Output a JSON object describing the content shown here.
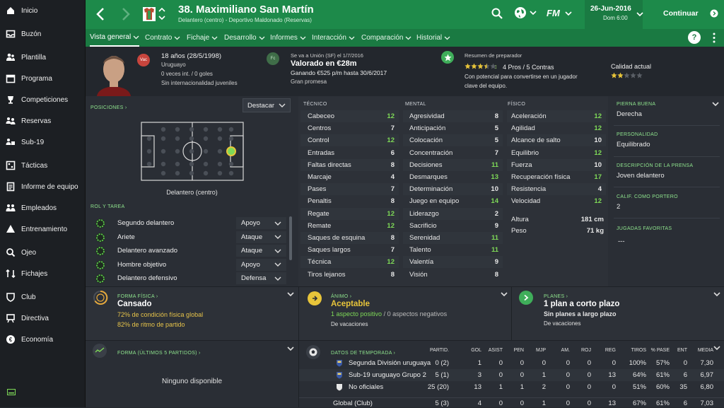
{
  "sidebar": {
    "items": [
      {
        "label": "Inicio",
        "icon": "home-icon"
      },
      {
        "label": "Buzón",
        "icon": "inbox-icon"
      },
      {
        "label": "Plantilla",
        "icon": "squad-icon"
      },
      {
        "label": "Programa",
        "icon": "schedule-icon"
      },
      {
        "label": "Competiciones",
        "icon": "trophy-icon"
      },
      {
        "label": "Reservas",
        "icon": "reserves-icon"
      },
      {
        "label": "Sub-19",
        "icon": "u19-icon"
      },
      {
        "label": "Tácticas",
        "icon": "tactics-icon"
      },
      {
        "label": "Informe de equipo",
        "icon": "report-icon"
      },
      {
        "label": "Empleados",
        "icon": "staff-icon"
      },
      {
        "label": "Entrenamiento",
        "icon": "training-icon"
      },
      {
        "label": "Ojeo",
        "icon": "scouting-icon"
      },
      {
        "label": "Fichajes",
        "icon": "transfers-icon"
      },
      {
        "label": "Club",
        "icon": "club-icon"
      },
      {
        "label": "Directiva",
        "icon": "board-icon"
      },
      {
        "label": "Economía",
        "icon": "finance-icon"
      }
    ]
  },
  "header": {
    "title": "38. Maximiliano San Martín",
    "subtitle": "Delantero (centro) - Deportivo Maldonado (Reservas)",
    "logo": "FM",
    "date": "26-Jun-2016",
    "time": "Dom 6:00",
    "continue": "Continuar"
  },
  "tabs": [
    "Vista general",
    "Contrato",
    "Fichaje",
    "Desarrollo",
    "Informes",
    "Interacción",
    "Comparación",
    "Historial"
  ],
  "profile": {
    "age": "18 años (28/5/1998)",
    "nationality": "Uruguayo",
    "caps": "0 veces int. / 0 goles",
    "youth": "Sin internacionalidad juveniles",
    "badge": "Vac",
    "contract_badge": "Fc",
    "transfer_note": "Se va a Unión (SF) el 1/7/2016",
    "valued": "Valorado en €28m",
    "wage": "Ganando €525 p/m hasta 30/6/2017",
    "promise": "Gran promesa"
  },
  "coach": {
    "heading": "Resumen de preparador",
    "pros": "4 Pros / 5 Contras",
    "desc1": "Con potencial para convertirse en un jugador",
    "desc2": "clave del equipo.",
    "ability_label": "Calidad actual",
    "stars_potential": 3.5,
    "stars_current": 2
  },
  "positions": {
    "heading": "POSICIONES",
    "dropdown": "Destacar",
    "position_label": "Delantero (centro)"
  },
  "roles": {
    "heading": "ROL Y TAREA",
    "items": [
      {
        "role": "Segundo delantero",
        "duty": "Apoyo"
      },
      {
        "role": "Ariete",
        "duty": "Ataque"
      },
      {
        "role": "Delantero avanzado",
        "duty": "Ataque"
      },
      {
        "role": "Hombre objetivo",
        "duty": "Apoyo"
      },
      {
        "role": "Delantero defensivo",
        "duty": "Defensa"
      }
    ]
  },
  "technical": {
    "heading": "TÉCNICO",
    "rows": [
      {
        "n": "Cabeceo",
        "v": "12",
        "g": true
      },
      {
        "n": "Centros",
        "v": "7",
        "g": false
      },
      {
        "n": "Control",
        "v": "12",
        "g": true
      },
      {
        "n": "Entradas",
        "v": "6",
        "g": false
      },
      {
        "n": "Faltas directas",
        "v": "8",
        "g": false
      },
      {
        "n": "Marcaje",
        "v": "4",
        "g": false
      },
      {
        "n": "Pases",
        "v": "7",
        "g": false
      },
      {
        "n": "Penaltis",
        "v": "8",
        "g": false
      },
      {
        "n": "Regate",
        "v": "12",
        "g": true
      },
      {
        "n": "Remate",
        "v": "12",
        "g": true
      },
      {
        "n": "Saques de esquina",
        "v": "8",
        "g": false
      },
      {
        "n": "Saques largos",
        "v": "7",
        "g": false
      },
      {
        "n": "Técnica",
        "v": "12",
        "g": true
      },
      {
        "n": "Tiros lejanos",
        "v": "8",
        "g": false
      }
    ]
  },
  "mental": {
    "heading": "MENTAL",
    "rows": [
      {
        "n": "Agresividad",
        "v": "8",
        "g": false
      },
      {
        "n": "Anticipación",
        "v": "5",
        "g": false
      },
      {
        "n": "Colocación",
        "v": "5",
        "g": false
      },
      {
        "n": "Concentración",
        "v": "7",
        "g": false
      },
      {
        "n": "Decisiones",
        "v": "11",
        "g": true
      },
      {
        "n": "Desmarques",
        "v": "13",
        "g": true
      },
      {
        "n": "Determinación",
        "v": "10",
        "g": false
      },
      {
        "n": "Juego en equipo",
        "v": "14",
        "g": true
      },
      {
        "n": "Liderazgo",
        "v": "2",
        "g": false
      },
      {
        "n": "Sacrificio",
        "v": "9",
        "g": false
      },
      {
        "n": "Serenidad",
        "v": "11",
        "g": true
      },
      {
        "n": "Talento",
        "v": "11",
        "g": true
      },
      {
        "n": "Valentía",
        "v": "9",
        "g": false
      },
      {
        "n": "Visión",
        "v": "8",
        "g": false
      }
    ]
  },
  "physical": {
    "heading": "FÍSICO",
    "rows": [
      {
        "n": "Aceleración",
        "v": "12",
        "g": true
      },
      {
        "n": "Agilidad",
        "v": "12",
        "g": true
      },
      {
        "n": "Alcance de salto",
        "v": "10",
        "g": false
      },
      {
        "n": "Equilibrio",
        "v": "12",
        "g": true
      },
      {
        "n": "Fuerza",
        "v": "10",
        "g": false
      },
      {
        "n": "Recuperación física",
        "v": "17",
        "g": true
      },
      {
        "n": "Resistencia",
        "v": "4",
        "g": false
      },
      {
        "n": "Velocidad",
        "v": "12",
        "g": true
      }
    ],
    "height_label": "Altura",
    "height": "181 cm",
    "weight_label": "Peso",
    "weight": "71 kg"
  },
  "info": {
    "foot_label": "PIERNA BUENA",
    "foot": "Derecha",
    "pers_label": "PERSONALIDAD",
    "pers": "Equilibrado",
    "press_label": "DESCRIPCIÓN DE LA PRENSA",
    "press": "Joven delantero",
    "gk_label": "CALIF. COMO PORTERO",
    "gk": "2",
    "moves_label": "JUGADAS FAVORITAS",
    "moves": "---"
  },
  "condition": {
    "heading": "FORMA FÍSICA",
    "status": "Cansado",
    "line1": "72% de condición física global",
    "line2": "82% de ritmo de partido"
  },
  "morale": {
    "heading": "ÁNIMO",
    "status": "Aceptable",
    "pos": "1 aspecto positivo",
    "neg": "/ 0 aspectos negativos",
    "note": "De vacaciones"
  },
  "plans": {
    "heading": "PLANES",
    "status": "1 plan a corto plazo",
    "sub": "Sin planes a largo plazo",
    "note": "De vacaciones"
  },
  "form": {
    "heading": "FORMA (ÚLTIMOS 5 PARTIDOS)",
    "empty": "Ninguno disponible"
  },
  "season": {
    "heading": "DATOS DE TEMPORADA",
    "cols": [
      "PARTID.",
      "GOL",
      "ASIST",
      "PEN",
      "MJP",
      "AM.",
      "ROJ",
      "REG",
      "TIROS",
      "% PASE",
      "ENT",
      "MEDIA"
    ],
    "rows": [
      {
        "name": "Segunda División uruguaya",
        "vals": [
          "0 (2)",
          "1",
          "0",
          "0",
          "0",
          "0",
          "0",
          "0",
          "100%",
          "57%",
          "0",
          "7,30"
        ]
      },
      {
        "name": "Sub-19 uruguayo Grupo 2",
        "vals": [
          "5 (1)",
          "3",
          "0",
          "0",
          "1",
          "0",
          "0",
          "13",
          "64%",
          "61%",
          "6",
          "6,97"
        ]
      },
      {
        "name": "No oficiales",
        "vals": [
          "25 (20)",
          "13",
          "1",
          "1",
          "2",
          "0",
          "0",
          "0",
          "51%",
          "60%",
          "35",
          "6,80"
        ]
      }
    ],
    "total": {
      "name": "Global (Club)",
      "vals": [
        "5 (3)",
        "4",
        "0",
        "0",
        "1",
        "0",
        "0",
        "13",
        "67%",
        "61%",
        "6",
        "7,03"
      ]
    }
  }
}
